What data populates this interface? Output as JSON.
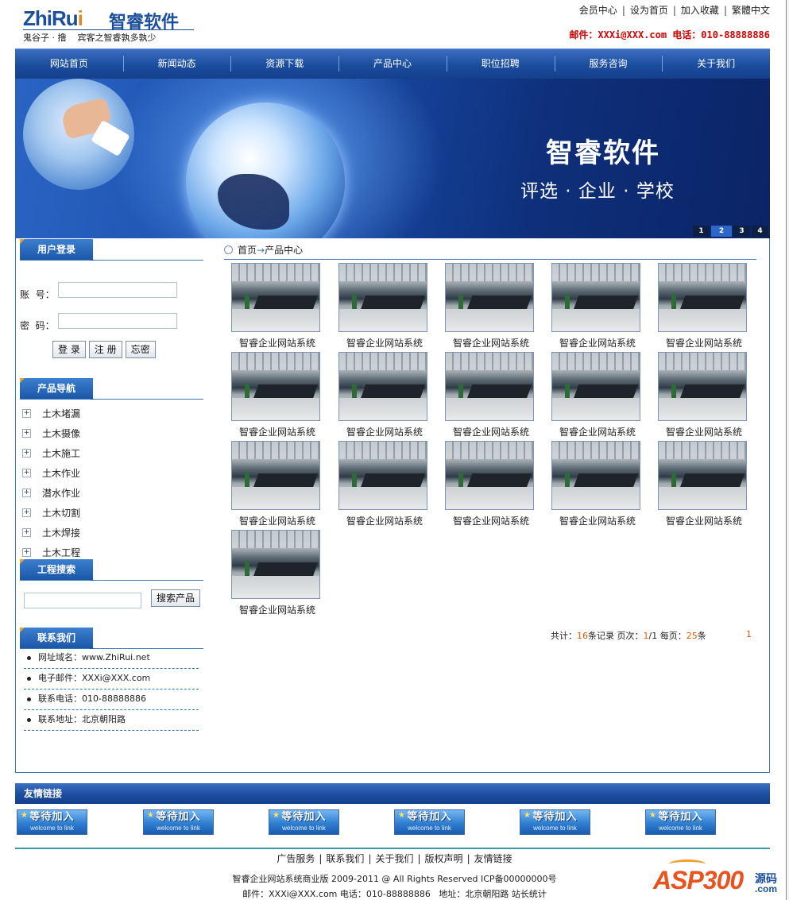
{
  "header": {
    "logo_en_a": "ZhiRu",
    "logo_en_b": "i",
    "logo_cn": "智睿软件",
    "slogan": "鬼谷子 · 撸    宾客之智睿孰多孰少",
    "top_links": [
      "会员中心",
      "设为首页",
      "加入收藏",
      "繁體中文"
    ],
    "top_contact": "邮件：XXXi@XXX.com 电话：010-88888886"
  },
  "nav": [
    "网站首页",
    "新闻动态",
    "资源下载",
    "产品中心",
    "职位招聘",
    "服务咨询",
    "关于我们"
  ],
  "banner": {
    "title": "智睿软件",
    "subtitle": "评选 · 企业 · 学校",
    "pager": [
      "1",
      "2",
      "3",
      "4"
    ],
    "active_page": 2
  },
  "login": {
    "title": "用户登录",
    "account_label": "账  号：",
    "password_label": "密  码：",
    "buttons": [
      "登 录",
      "注 册",
      "忘密"
    ]
  },
  "product_nav": {
    "title": "产品导航",
    "items": [
      "土木堵漏",
      "土木摄像",
      "土木施工",
      "土木作业",
      "潜水作业",
      "土木切割",
      "土木焊接",
      "土木工程"
    ]
  },
  "search": {
    "title": "工程搜索",
    "button": "搜索产品"
  },
  "contact": {
    "title": "联系我们",
    "items": [
      "网址域名：www.ZhiRui.net",
      "电子邮件：XXXi@XXX.com",
      "联系电话：010-88888886",
      "联系地址：北京朝阳路"
    ]
  },
  "breadcrumb": {
    "home": "首页",
    "arrow": "→",
    "current": "产品中心"
  },
  "products": [
    "智睿企业网站系统",
    "智睿企业网站系统",
    "智睿企业网站系统",
    "智睿企业网站系统",
    "智睿企业网站系统",
    "智睿企业网站系统",
    "智睿企业网站系统",
    "智睿企业网站系统",
    "智睿企业网站系统",
    "智睿企业网站系统",
    "智睿企业网站系统",
    "智睿企业网站系统",
    "智睿企业网站系统",
    "智睿企业网站系统",
    "智睿企业网站系统",
    "智睿企业网站系统"
  ],
  "pagination": {
    "total_prefix": "共计：",
    "total": "16",
    "total_suffix": "条记录 页次：",
    "page": "1",
    "page_sep": "/1 每页：",
    "per_page": "25",
    "per_suffix": "条",
    "page_link": "1"
  },
  "links": {
    "title": "友情链接",
    "badge_main": "等待加入",
    "badge_sub": "welcome to link",
    "count": 6
  },
  "footer": {
    "nav": [
      "广告服务",
      "联系我们",
      "关于我们",
      "版权声明",
      "友情链接"
    ],
    "copyright": "智睿企业网站系统商业版 2009-2011 @ All Rights Reserved ICP备00000000号",
    "contact": "邮件：XXXi@XXX.com 电话：010-88888886   地址：北京朝阳路 站长统计"
  },
  "watermark": {
    "main": "ASP300",
    "cn": "源码",
    "domain": ".com"
  },
  "colors": {
    "nav_blue": "#1b4d9e",
    "accent_orange": "#e05a00",
    "contact_red": "#d20000",
    "border_blue": "#3a78b6"
  }
}
